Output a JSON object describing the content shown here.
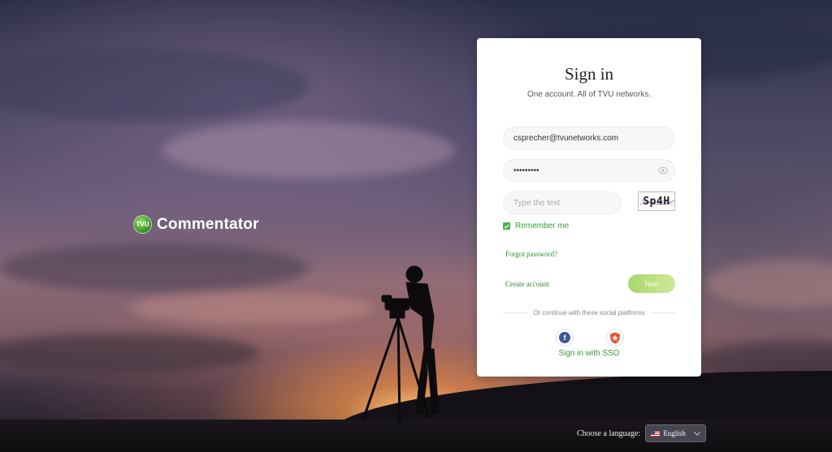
{
  "brand": {
    "logo_text": "TVU",
    "name": "Commentator"
  },
  "signin": {
    "title": "Sign in",
    "subtitle": "One account. All of TVU networks.",
    "email_value": "csprecher@tvunetworks.com",
    "password_value": "•••••••••",
    "captcha_placeholder": "Type the text",
    "captcha_text": "Sp4H",
    "remember_label": "Remember me",
    "remember_checked": true,
    "forgot_label": "Forgot password?",
    "create_label": "Create account",
    "next_label": "Next",
    "social_divider": "Or continue with these social platforms",
    "sso_label": "Sign in with SSO"
  },
  "social": [
    {
      "icon": "facebook-icon",
      "letter": "f",
      "color": "#3b5998"
    },
    {
      "icon": "auth0-icon",
      "color": "#e8542a"
    }
  ],
  "language": {
    "label": "Choose a language:",
    "selected": "English"
  }
}
